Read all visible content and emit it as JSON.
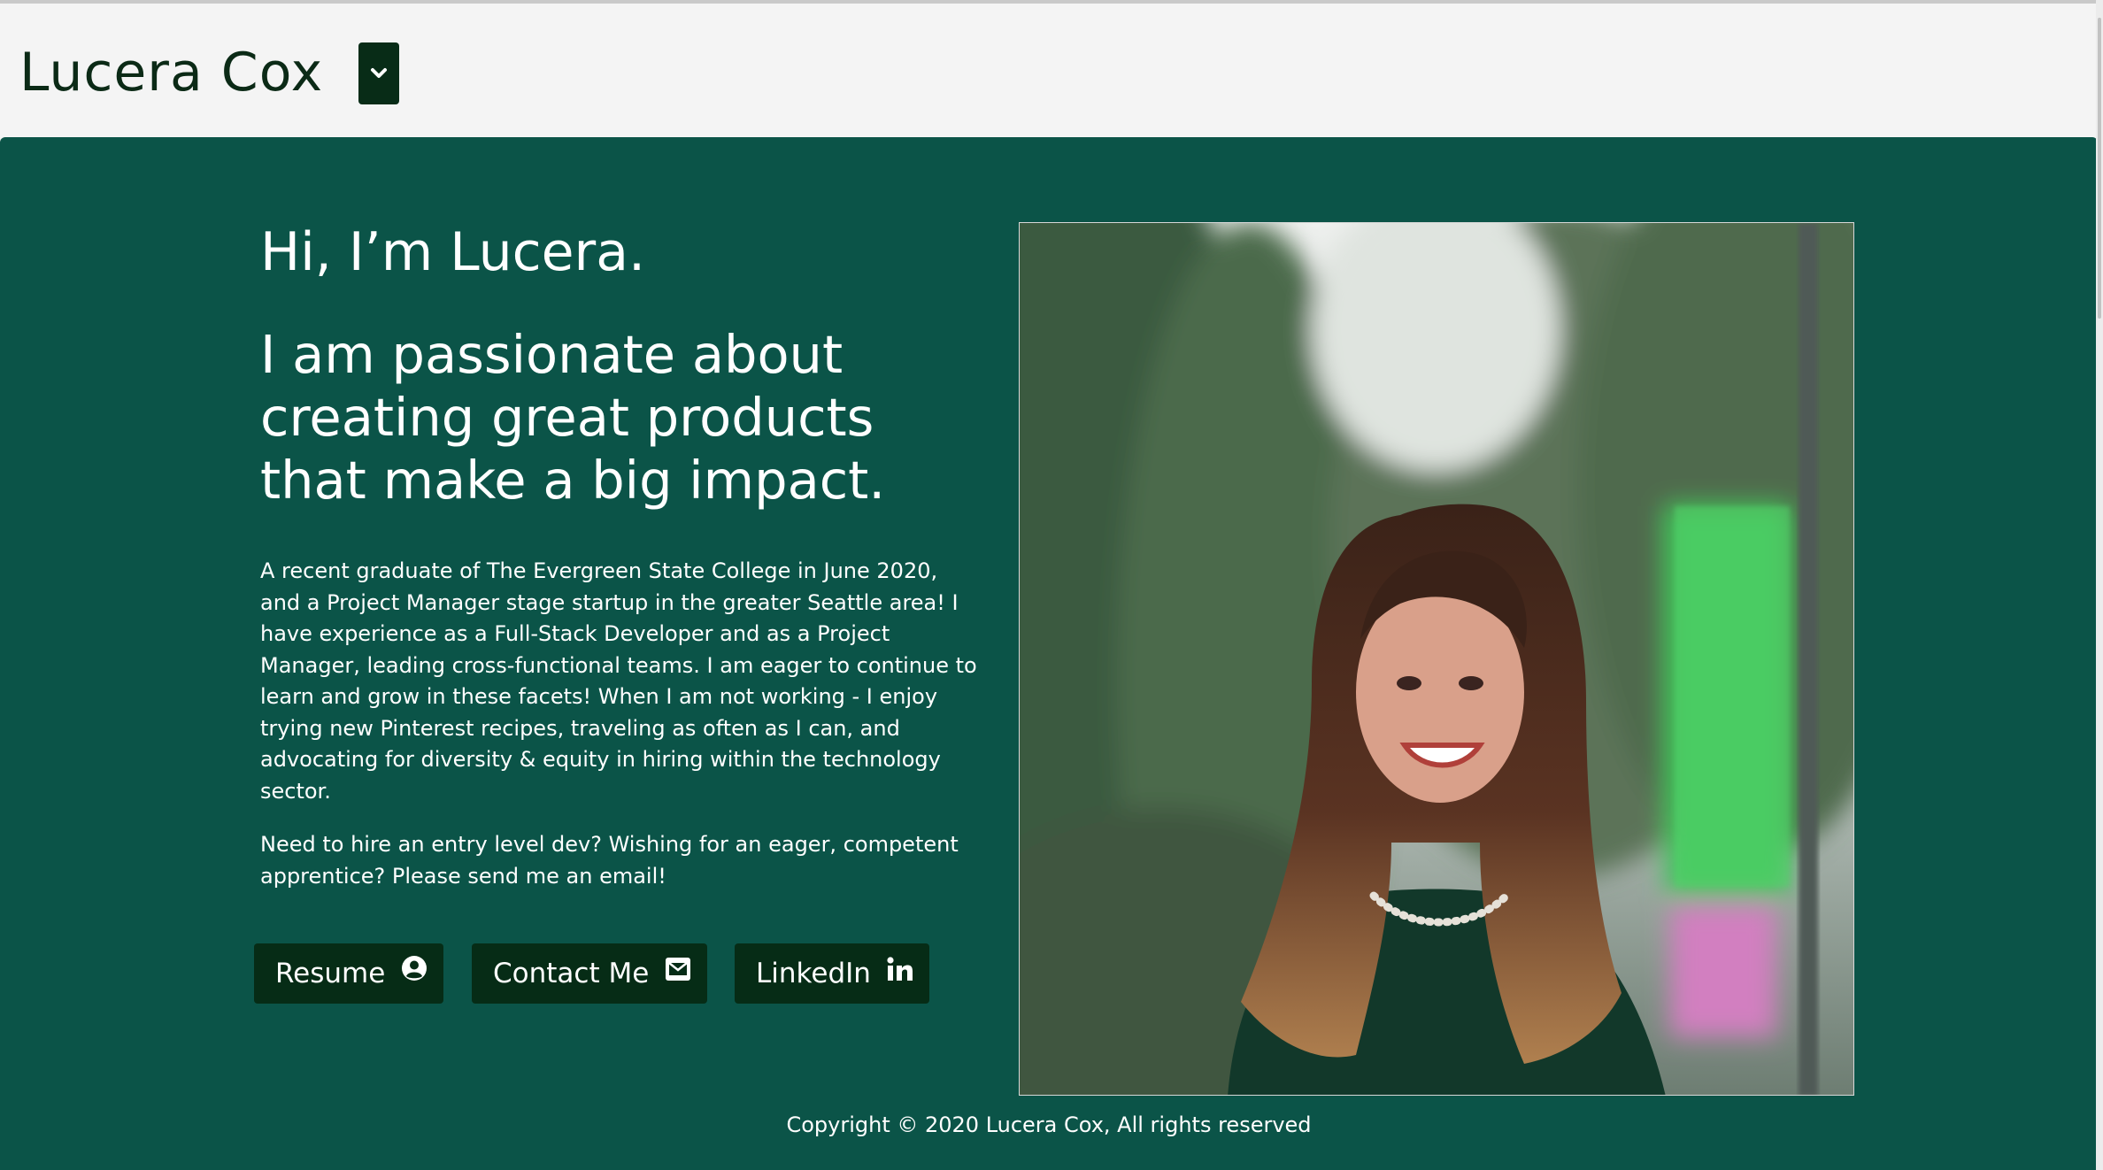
{
  "header": {
    "brand": "Lucera Cox",
    "menu_toggle_icon": "chevron-down-icon"
  },
  "hero": {
    "greeting": "Hi, I’m Lucera.",
    "tagline": "I am passionate about creating great products that make a big impact.",
    "bio": "A recent graduate of The Evergreen State College in June 2020, and a Project Manager stage startup in the greater Seattle area! I have experience as a Full-Stack Developer and as a Project Manager, leading cross-functional teams. I am eager to continue to learn and grow in these facets! When I am not working - I enjoy trying new Pinterest recipes, traveling as often as I can, and advocating for diversity & equity in hiring within the technology sector.",
    "cta": "Need to hire an entry level dev? Wishing for an eager, competent apprentice? Please send me an email!",
    "buttons": [
      {
        "label": "Resume",
        "icon": "user-circle-icon"
      },
      {
        "label": "Contact Me",
        "icon": "envelope-icon"
      },
      {
        "label": "LinkedIn",
        "icon": "linkedin-icon"
      }
    ]
  },
  "footer": {
    "copyright": "Copyright © 2020 Lucera Cox, All rights reserved"
  },
  "colors": {
    "header_bg": "#f4f4f4",
    "main_bg": "#0b5448",
    "button_bg": "#062c16",
    "text_dark": "#0b2a16",
    "text_light": "#ffffff"
  }
}
